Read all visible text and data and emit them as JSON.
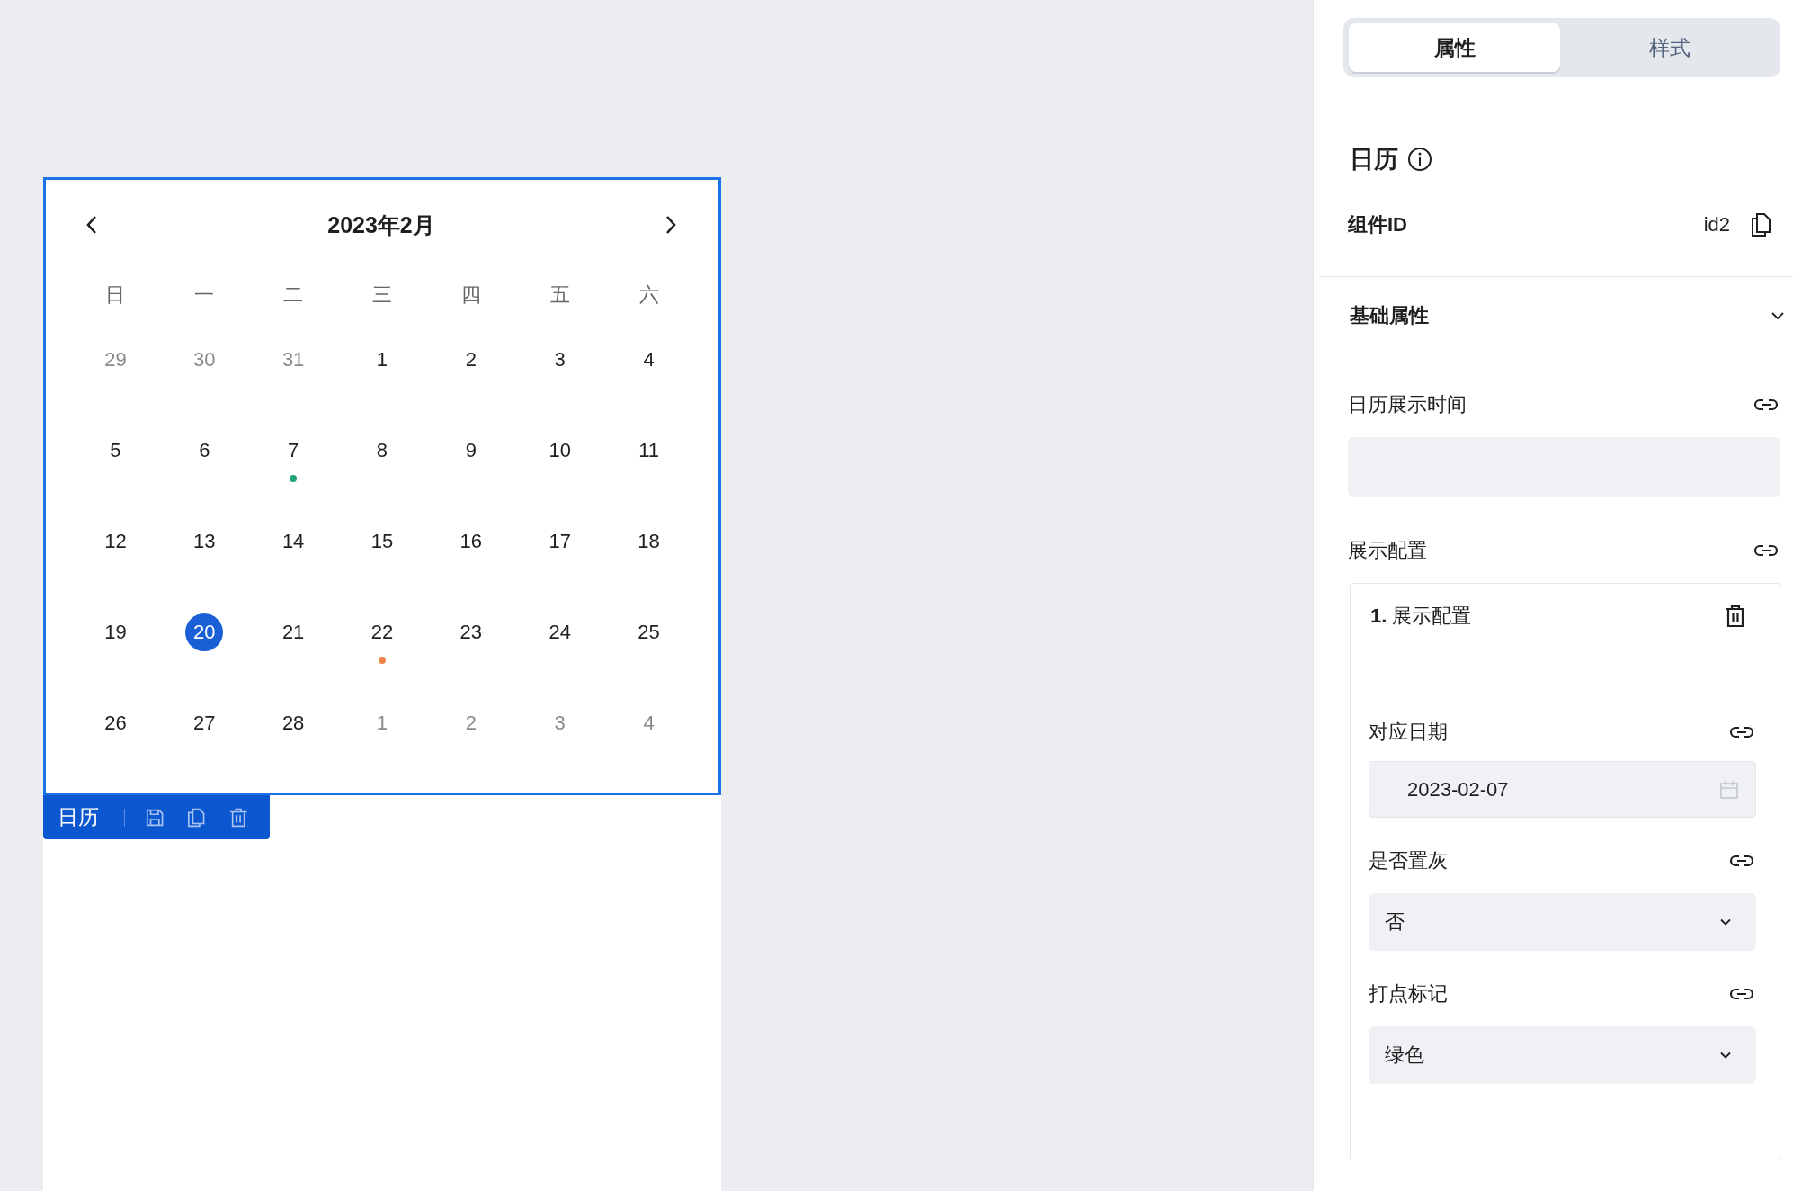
{
  "canvas": {
    "calendar": {
      "title": "2023年2月",
      "weekdays": [
        "日",
        "一",
        "二",
        "三",
        "四",
        "五",
        "六"
      ],
      "weeks": [
        [
          {
            "day": "29",
            "other_month": true,
            "selected": false
          },
          {
            "day": "30",
            "other_month": true,
            "selected": false
          },
          {
            "day": "31",
            "other_month": true,
            "selected": false
          },
          {
            "day": "1",
            "other_month": false,
            "selected": false
          },
          {
            "day": "2",
            "other_month": false,
            "selected": false
          },
          {
            "day": "3",
            "other_month": false,
            "selected": false
          },
          {
            "day": "4",
            "other_month": false,
            "selected": false
          }
        ],
        [
          {
            "day": "5",
            "other_month": false,
            "selected": false
          },
          {
            "day": "6",
            "other_month": false,
            "selected": false
          },
          {
            "day": "7",
            "other_month": false,
            "selected": false,
            "color": "#22a37a"
          },
          {
            "day": "8",
            "other_month": false,
            "selected": false
          },
          {
            "day": "9",
            "other_month": false,
            "selected": false
          },
          {
            "day": "10",
            "other_month": false,
            "selected": false
          },
          {
            "day": "11",
            "other_month": false,
            "selected": false
          }
        ],
        [
          {
            "day": "12",
            "other_month": false,
            "selected": false
          },
          {
            "day": "13",
            "other_month": false,
            "selected": false
          },
          {
            "day": "14",
            "other_month": false,
            "selected": false
          },
          {
            "day": "15",
            "other_month": false,
            "selected": false
          },
          {
            "day": "16",
            "other_month": false,
            "selected": false
          },
          {
            "day": "17",
            "other_month": false,
            "selected": false
          },
          {
            "day": "18",
            "other_month": false,
            "selected": false
          }
        ],
        [
          {
            "day": "19",
            "other_month": false,
            "selected": false
          },
          {
            "day": "20",
            "other_month": false,
            "selected": true
          },
          {
            "day": "21",
            "other_month": false,
            "selected": false
          },
          {
            "day": "22",
            "other_month": false,
            "selected": false,
            "color": "#f0834a"
          },
          {
            "day": "23",
            "other_month": false,
            "selected": false
          },
          {
            "day": "24",
            "other_month": false,
            "selected": false
          },
          {
            "day": "25",
            "other_month": false,
            "selected": false
          }
        ],
        [
          {
            "day": "26",
            "other_month": false,
            "selected": false
          },
          {
            "day": "27",
            "other_month": false,
            "selected": false
          },
          {
            "day": "28",
            "other_month": false,
            "selected": false
          },
          {
            "day": "1",
            "other_month": true,
            "selected": false
          },
          {
            "day": "2",
            "other_month": true,
            "selected": false
          },
          {
            "day": "3",
            "other_month": true,
            "selected": false
          },
          {
            "day": "4",
            "other_month": true,
            "selected": false
          }
        ]
      ]
    },
    "toolbar": {
      "label": "日历"
    }
  },
  "panel": {
    "tabs": [
      {
        "label": "属性",
        "selected": true
      },
      {
        "label": "样式",
        "selected": false
      }
    ],
    "component_title": "日历",
    "id_row": {
      "label": "组件ID",
      "value": "id2"
    },
    "section": {
      "title": "基础属性",
      "expanded": true
    },
    "display_time": {
      "label": "日历展示时间"
    },
    "display_config": {
      "label": "展示配置",
      "items": [
        {
          "title": "**1.** 展示配置",
          "fields": [
            {
              "kind": "date",
              "label": "对应日期",
              "value": "2023-02-07"
            },
            {
              "kind": "select",
              "label": "是否置灰",
              "value": "否"
            },
            {
              "kind": "select",
              "label": "打点标记",
              "value": "绿色"
            }
          ]
        }
      ]
    }
  }
}
